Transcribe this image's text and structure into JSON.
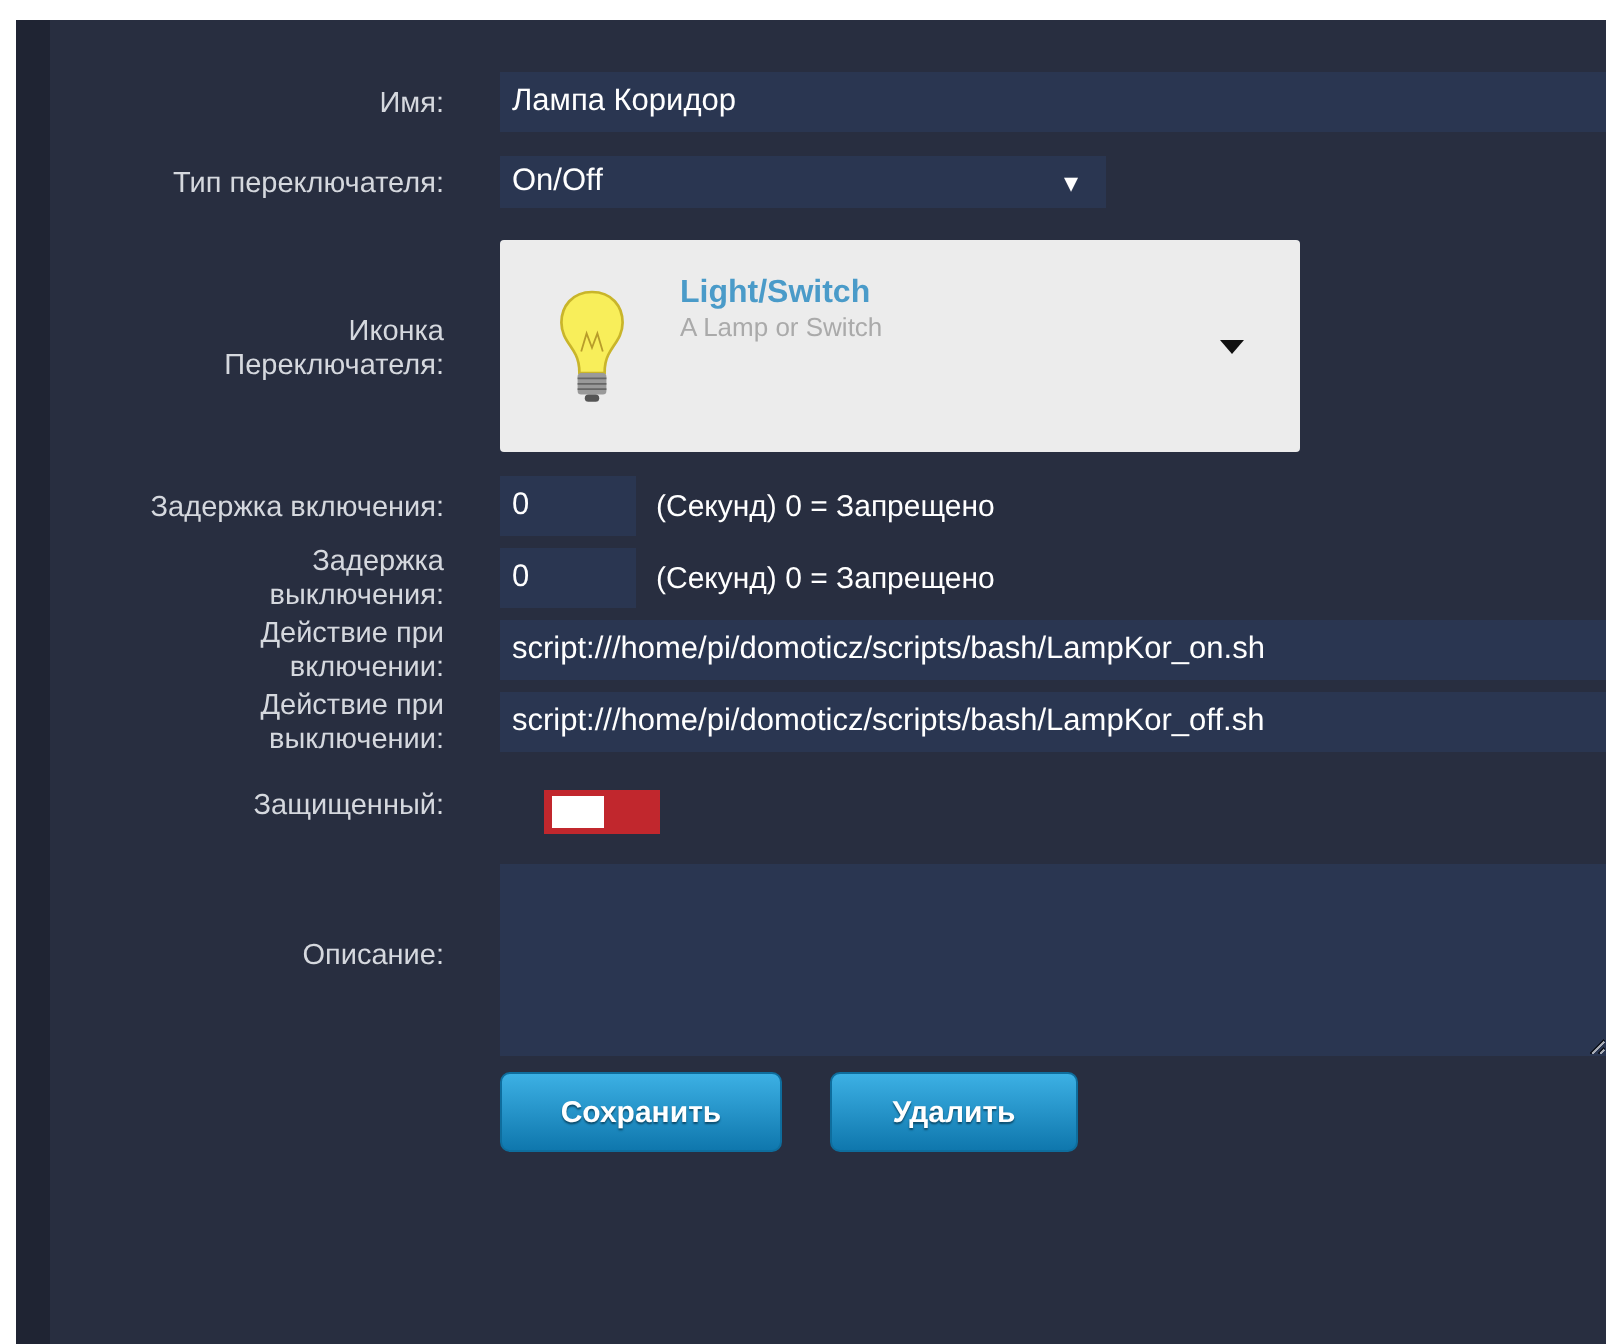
{
  "form": {
    "name": {
      "label": "Имя:",
      "value": "Лампа Коридор"
    },
    "switch_type": {
      "label": "Тип переключателя:",
      "value": "On/Off",
      "caret": "▾"
    },
    "switch_icon": {
      "label": "Иконка Переключателя:",
      "title": "Light/Switch",
      "subtitle": "A Lamp or Switch"
    },
    "on_delay": {
      "label": "Задержка включения:",
      "value": "0",
      "hint": "(Секунд) 0 = Запрещено"
    },
    "off_delay": {
      "label": "Задержка выключения:",
      "value": "0",
      "hint": "(Секунд) 0 = Запрещено"
    },
    "on_action": {
      "label": "Действие при включении:",
      "value": "script:///home/pi/domoticz/scripts/bash/LampKor_on.sh"
    },
    "off_action": {
      "label": "Действие при выключении:",
      "value": "script:///home/pi/domoticz/scripts/bash/LampKor_off.sh"
    },
    "protected": {
      "label": "Защищенный:",
      "checked": false
    },
    "description": {
      "label": "Описание:"
    },
    "buttons": [
      "Сохранить",
      "Удалить"
    ]
  }
}
